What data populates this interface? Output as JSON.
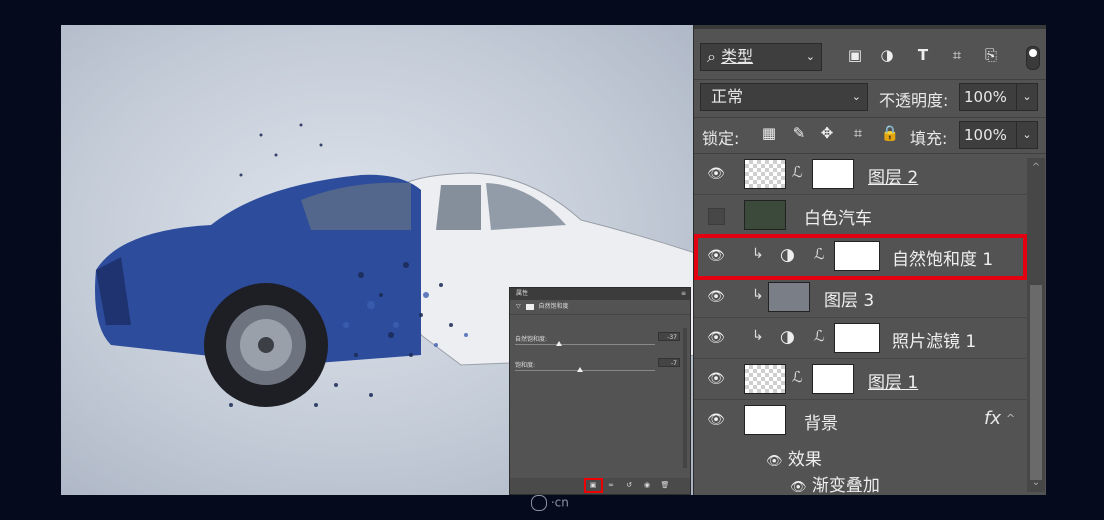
{
  "layers_panel": {
    "filter_kind": "类型",
    "blend_mode": "正常",
    "opacity_label": "不透明度:",
    "opacity_value": "100%",
    "lock_label": "锁定:",
    "fill_label": "填充:",
    "fill_value": "100%",
    "layers": [
      {
        "name": "图层 2",
        "visible": true
      },
      {
        "name": "白色汽车",
        "visible": false
      },
      {
        "name": "自然饱和度 1",
        "visible": true,
        "highlighted": true
      },
      {
        "name": "图层 3",
        "visible": true
      },
      {
        "name": "照片滤镜 1",
        "visible": true
      },
      {
        "name": "图层 1",
        "visible": true
      },
      {
        "name": "背景",
        "visible": true,
        "fx": "fx"
      }
    ],
    "effects_label": "效果",
    "effect_item": "渐变叠加"
  },
  "properties_panel": {
    "tab_title": "属性",
    "adjustment_name": "自然饱和度",
    "vibrance_label": "自然饱和度:",
    "vibrance_value": "-37",
    "vibrance_level": -0.37,
    "saturation_label": "饱和度:",
    "saturation_value": "-7",
    "saturation_level": -0.07
  },
  "watermark": "·cn",
  "colors": {
    "highlight": "#e30010",
    "panel": "#535353",
    "background": "#050b1d"
  }
}
